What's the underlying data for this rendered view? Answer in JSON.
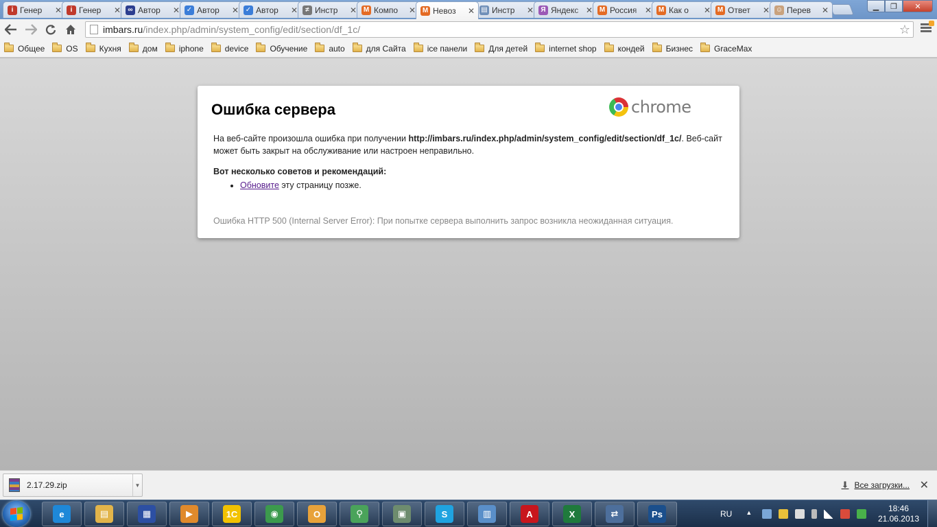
{
  "tabs": [
    {
      "title": "Генер",
      "icon": "i-red-icon",
      "color": "#c0392b",
      "glyph": "i",
      "active": false
    },
    {
      "title": "Генер",
      "icon": "i-red-icon",
      "color": "#c0392b",
      "glyph": "i",
      "active": false
    },
    {
      "title": "Автор",
      "icon": "infinity-icon",
      "color": "#2c3e8f",
      "glyph": "∞",
      "active": false
    },
    {
      "title": "Автор",
      "icon": "checkmark-icon",
      "color": "#3b7dd8",
      "glyph": "✓",
      "active": false
    },
    {
      "title": "Автор",
      "icon": "checkmark-icon",
      "color": "#3b7dd8",
      "glyph": "✓",
      "active": false
    },
    {
      "title": "Инстр",
      "icon": "tools-icon",
      "color": "#777777",
      "glyph": "≠",
      "active": false
    },
    {
      "title": "Компо",
      "icon": "magento-icon",
      "color": "#e46b24",
      "glyph": "M",
      "active": false
    },
    {
      "title": "Невоз",
      "icon": "magento-icon",
      "color": "#e46b24",
      "glyph": "M",
      "active": true
    },
    {
      "title": "Инстр",
      "icon": "page-icon",
      "color": "#6f8fb8",
      "glyph": "▤",
      "active": false
    },
    {
      "title": "Яндекс",
      "icon": "yandex-icon",
      "color": "#9b59b6",
      "glyph": "Я",
      "active": false
    },
    {
      "title": "Россия",
      "icon": "magento-icon",
      "color": "#e46b24",
      "glyph": "M",
      "active": false
    },
    {
      "title": "Как о",
      "icon": "magento-icon",
      "color": "#e46b24",
      "glyph": "M",
      "active": false
    },
    {
      "title": "Ответ",
      "icon": "magento-icon",
      "color": "#e46b24",
      "glyph": "M",
      "active": false
    },
    {
      "title": "Перев",
      "icon": "person-icon",
      "color": "#c9a27d",
      "glyph": "☺",
      "active": false
    }
  ],
  "address": {
    "host": "imbars.ru",
    "path": "/index.php/admin/system_config/edit/section/df_1c/"
  },
  "bookmarks": [
    "Общее",
    "OS",
    "Кухня",
    "дом",
    "iphone",
    "device",
    "Обучение",
    "auto",
    "для Сайта",
    "ice панели",
    "Для детей",
    "internet shop",
    "кондей",
    "Бизнес",
    "GraceMax"
  ],
  "error": {
    "title": "Ошибка сервера",
    "brand": "chrome",
    "msg_before": "На веб-сайте произошла ошибка при получении ",
    "msg_url": "http://imbars.ru/index.php/admin/system_config/edit/section/df_1c/",
    "msg_after": ". Веб-сайт может быть закрыт на обслуживание или настроен неправильно.",
    "tips_heading": "Вот несколько советов и рекомендаций:",
    "tip_link": "Обновите",
    "tip_rest": " эту страницу позже.",
    "code_text": "Ошибка HTTP 500 (Internal Server Error): При попытке сервера выполнить запрос возникла неожиданная ситуация."
  },
  "downloads": {
    "file": "2.17.29.zip",
    "all_label": "Все загрузки..."
  },
  "taskbar": {
    "apps": [
      {
        "name": "ie-icon",
        "color": "#1e88d8",
        "glyph": "e"
      },
      {
        "name": "explorer-icon",
        "color": "#e2b44a",
        "glyph": "▤"
      },
      {
        "name": "calculator-icon",
        "color": "#2c4fa3",
        "glyph": "▦"
      },
      {
        "name": "media-player-icon",
        "color": "#e08a2c",
        "glyph": "▶"
      },
      {
        "name": "1c-icon",
        "color": "#f2c200",
        "glyph": "1С"
      },
      {
        "name": "chrome-icon",
        "color": "#3c9a4d",
        "glyph": "◉"
      },
      {
        "name": "outlook-icon",
        "color": "#e8a23a",
        "glyph": "O"
      },
      {
        "name": "network-icon",
        "color": "#4aa35a",
        "glyph": "⚲"
      },
      {
        "name": "monitor-icon",
        "color": "#6e8c6e",
        "glyph": "▣"
      },
      {
        "name": "skype-icon",
        "color": "#1fa3e0",
        "glyph": "S"
      },
      {
        "name": "control-panel-icon",
        "color": "#5a8fc9",
        "glyph": "▥"
      },
      {
        "name": "acrobat-icon",
        "color": "#c8161d",
        "glyph": "A"
      },
      {
        "name": "excel-icon",
        "color": "#1f7a3c",
        "glyph": "X"
      },
      {
        "name": "remote-desktop-icon",
        "color": "#4d6f9c",
        "glyph": "⇄"
      },
      {
        "name": "photoshop-icon",
        "color": "#1b4f8c",
        "glyph": "Ps"
      }
    ],
    "lang": "RU",
    "time": "18:46",
    "date": "21.06.2013"
  }
}
